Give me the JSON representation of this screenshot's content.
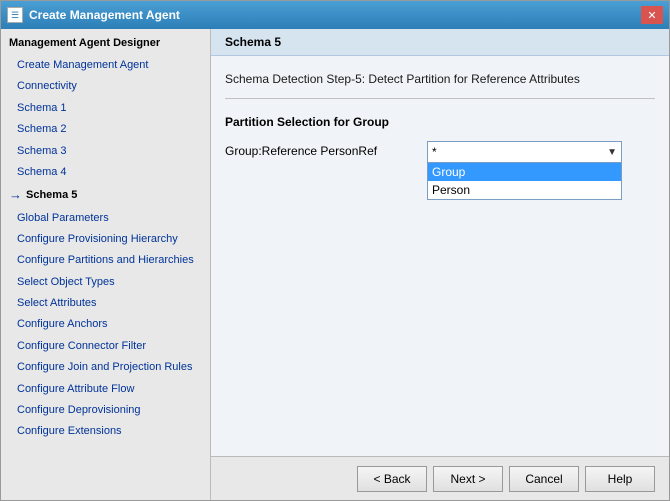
{
  "window": {
    "title": "Create Management Agent",
    "icon": "☰"
  },
  "sidebar": {
    "header": "Management Agent Designer",
    "items": [
      {
        "label": "Create Management Agent",
        "active": false,
        "indent": true
      },
      {
        "label": "Connectivity",
        "active": false,
        "indent": true
      },
      {
        "label": "Schema 1",
        "active": false,
        "indent": true
      },
      {
        "label": "Schema 2",
        "active": false,
        "indent": true
      },
      {
        "label": "Schema 3",
        "active": false,
        "indent": true
      },
      {
        "label": "Schema 4",
        "active": false,
        "indent": true
      },
      {
        "label": "Schema 5",
        "active": true,
        "indent": false
      },
      {
        "label": "Global Parameters",
        "active": false,
        "indent": true
      },
      {
        "label": "Configure Provisioning Hierarchy",
        "active": false,
        "indent": true
      },
      {
        "label": "Configure Partitions and Hierarchies",
        "active": false,
        "indent": true
      },
      {
        "label": "Select Object Types",
        "active": false,
        "indent": true
      },
      {
        "label": "Select Attributes",
        "active": false,
        "indent": true
      },
      {
        "label": "Configure Anchors",
        "active": false,
        "indent": true
      },
      {
        "label": "Configure Connector Filter",
        "active": false,
        "indent": true
      },
      {
        "label": "Configure Join and Projection Rules",
        "active": false,
        "indent": true
      },
      {
        "label": "Configure Attribute Flow",
        "active": false,
        "indent": true
      },
      {
        "label": "Configure Deprovisioning",
        "active": false,
        "indent": true
      },
      {
        "label": "Configure Extensions",
        "active": false,
        "indent": true
      }
    ]
  },
  "main": {
    "header": "Schema 5",
    "detection_step": "Schema Detection Step-5: Detect Partition for Reference Attributes",
    "partition_title": "Partition Selection for Group",
    "field_label": "Group:Reference PersonRef",
    "dropdown": {
      "value": "*",
      "options": [
        {
          "label": "Group",
          "highlighted": true
        },
        {
          "label": "Person",
          "highlighted": false
        }
      ]
    }
  },
  "footer": {
    "back_label": "< Back",
    "next_label": "Next >",
    "cancel_label": "Cancel",
    "help_label": "Help"
  }
}
